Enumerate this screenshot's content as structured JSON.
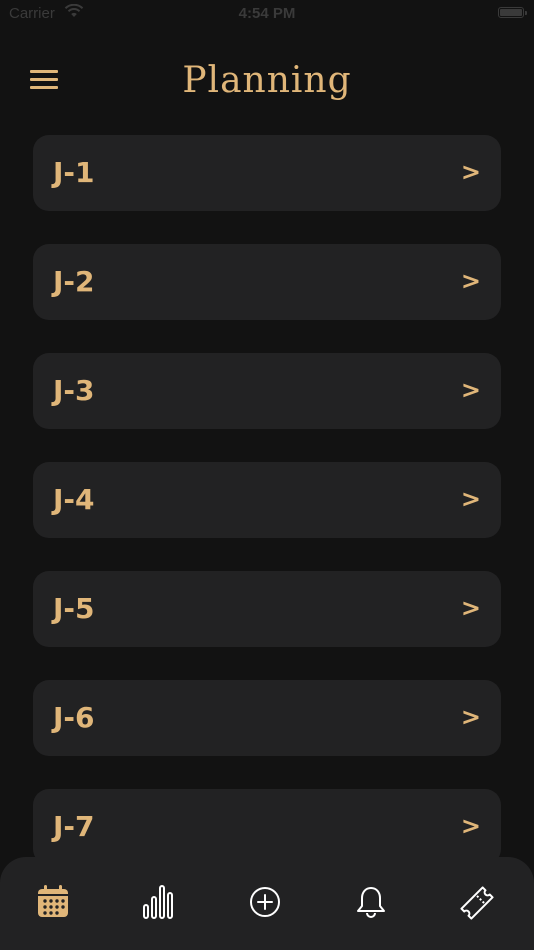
{
  "status_bar": {
    "carrier": "Carrier",
    "time": "4:54 PM"
  },
  "header": {
    "menu_icon": "hamburger-menu-icon",
    "title": "Planning"
  },
  "planning_list": {
    "items": [
      {
        "label": "J-1",
        "chevron": ">"
      },
      {
        "label": "J-2",
        "chevron": ">"
      },
      {
        "label": "J-3",
        "chevron": ">"
      },
      {
        "label": "J-4",
        "chevron": ">"
      },
      {
        "label": "J-5",
        "chevron": ">"
      },
      {
        "label": "J-6",
        "chevron": ">"
      },
      {
        "label": "J-7",
        "chevron": ">"
      }
    ]
  },
  "tab_bar": {
    "tabs": [
      {
        "icon": "calendar-icon",
        "selected": true
      },
      {
        "icon": "bar-chart-icon",
        "selected": false
      },
      {
        "icon": "add-circle-icon",
        "selected": false
      },
      {
        "icon": "bell-icon",
        "selected": false
      },
      {
        "icon": "ticket-icon",
        "selected": false
      }
    ]
  },
  "colors": {
    "background": "#121212",
    "card": "#222223",
    "accent": "#e0b679",
    "icon_inactive": "#ffffff"
  }
}
